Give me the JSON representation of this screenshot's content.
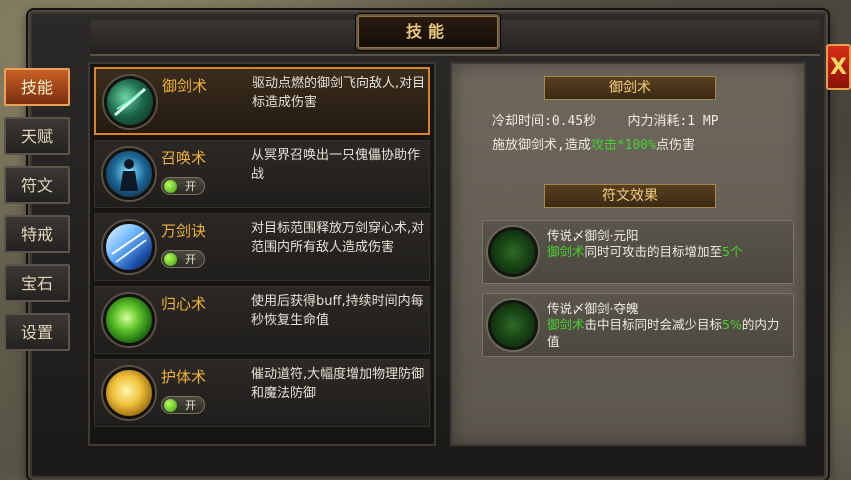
{
  "window": {
    "title": "技能",
    "close_label": "X"
  },
  "side_tabs": [
    {
      "label": "技能",
      "active": true
    },
    {
      "label": "天赋",
      "active": false
    },
    {
      "label": "符文",
      "active": false
    },
    {
      "label": "特戒",
      "active": false
    },
    {
      "label": "宝石",
      "active": false
    },
    {
      "label": "设置",
      "active": false
    }
  ],
  "skills": [
    {
      "name": "御剑术",
      "toggle": null,
      "desc": "驱动点燃的御剑飞向敌人,对目标造成伤害",
      "icon": "sword-skill-icon"
    },
    {
      "name": "召唤术",
      "toggle": "开",
      "desc": "从冥界召唤出一只傀儡协助作战",
      "icon": "summon-skill-icon"
    },
    {
      "name": "万剑诀",
      "toggle": "开",
      "desc": "对目标范围释放万剑穿心术,对范围内所有敌人造成伤害",
      "icon": "ten-thousand-swords-icon"
    },
    {
      "name": "归心术",
      "toggle": null,
      "desc": "使用后获得buff,持续时间内每秒恢复生命值",
      "icon": "heal-skill-icon"
    },
    {
      "name": "护体术",
      "toggle": "开",
      "desc": "催动道符,大幅度增加物理防御和魔法防御",
      "icon": "protect-skill-icon"
    }
  ],
  "detail": {
    "skill_title": "御剑术",
    "cooldown": "冷却时间:0.45秒",
    "mana_cost": "内力消耗:1 MP",
    "effect_prefix": "施放御剑术,造成",
    "effect_highlight": "攻击*100%",
    "effect_suffix": "点伤害",
    "rune_section_title": "符文效果",
    "runes": [
      {
        "title": "传说&#8855;御剑·元阳",
        "desc_hl1": "御剑术",
        "desc_mid": "同时可攻击的目标增加至",
        "desc_hl2": "5个",
        "desc_end": ""
      },
      {
        "title": "传说&#8855;御剑·夺魄",
        "desc_hl1": "御剑术",
        "desc_mid": "击中目标同时会减少目标",
        "desc_hl2": "5%",
        "desc_end": "的内力值"
      }
    ]
  },
  "colors": {
    "accent": "#d98526",
    "highlight": "#49d132",
    "name": "#f0b23a"
  }
}
